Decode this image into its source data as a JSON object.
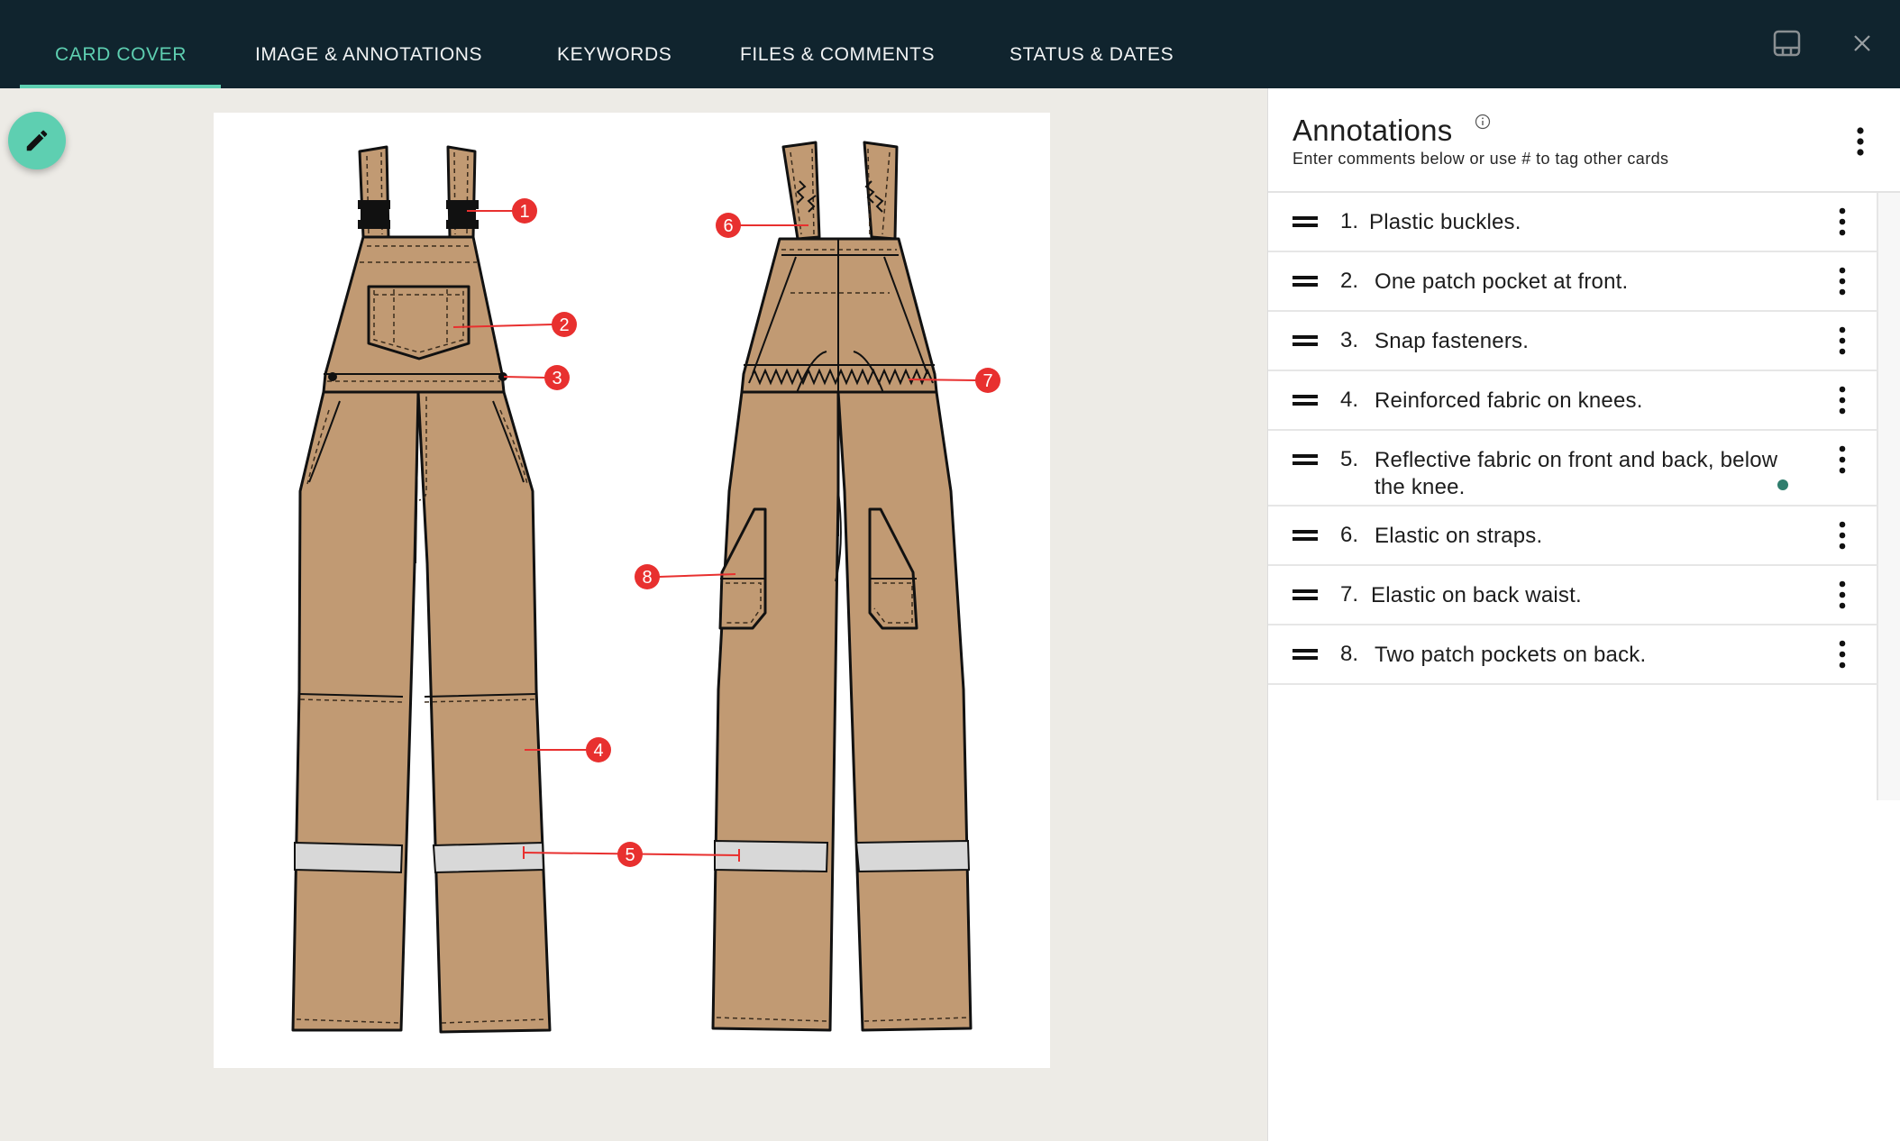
{
  "header": {
    "tabs": [
      {
        "label": "CARD COVER",
        "active": true
      },
      {
        "label": "IMAGE & ANNOTATIONS",
        "active": false
      },
      {
        "label": "KEYWORDS",
        "active": false
      },
      {
        "label": "FILES & COMMENTS",
        "active": false
      },
      {
        "label": "STATUS & DATES",
        "active": false
      }
    ],
    "icons": {
      "layout": "layout-panel-icon",
      "close": "close-icon"
    }
  },
  "colors": {
    "header_bg": "#10242e",
    "accent": "#5ecfb1",
    "main_bg": "#edebe6",
    "callout_red": "#e8302f",
    "garment_fill": "#c19a73",
    "reflective_band": "#d8d8d8",
    "status_dot": "#2f7d6d"
  },
  "main": {
    "edit_button_icon": "pencil-icon",
    "image": {
      "description": "Technical flat drawing of tan work overalls, front and back views, with numbered red callouts",
      "callouts": [
        "1",
        "2",
        "3",
        "4",
        "5",
        "6",
        "7",
        "8"
      ]
    }
  },
  "panel": {
    "title": "Annotations",
    "subtitle": "Enter comments below or use # to tag other cards",
    "annotations": [
      {
        "number": "1.",
        "text": "Plastic buckles."
      },
      {
        "number": "2.",
        "text": "One patch pocket at front."
      },
      {
        "number": "3.",
        "text": "Snap fasteners."
      },
      {
        "number": "4.",
        "text": "Reinforced fabric on knees."
      },
      {
        "number": "5.",
        "text": "Reflective fabric on front and back, below the knee.",
        "has_indicator": true
      },
      {
        "number": "6.",
        "text": "Elastic on straps."
      },
      {
        "number": "7.",
        "text": "Elastic on back waist."
      },
      {
        "number": "8.",
        "text": "Two patch pockets on back."
      }
    ]
  }
}
